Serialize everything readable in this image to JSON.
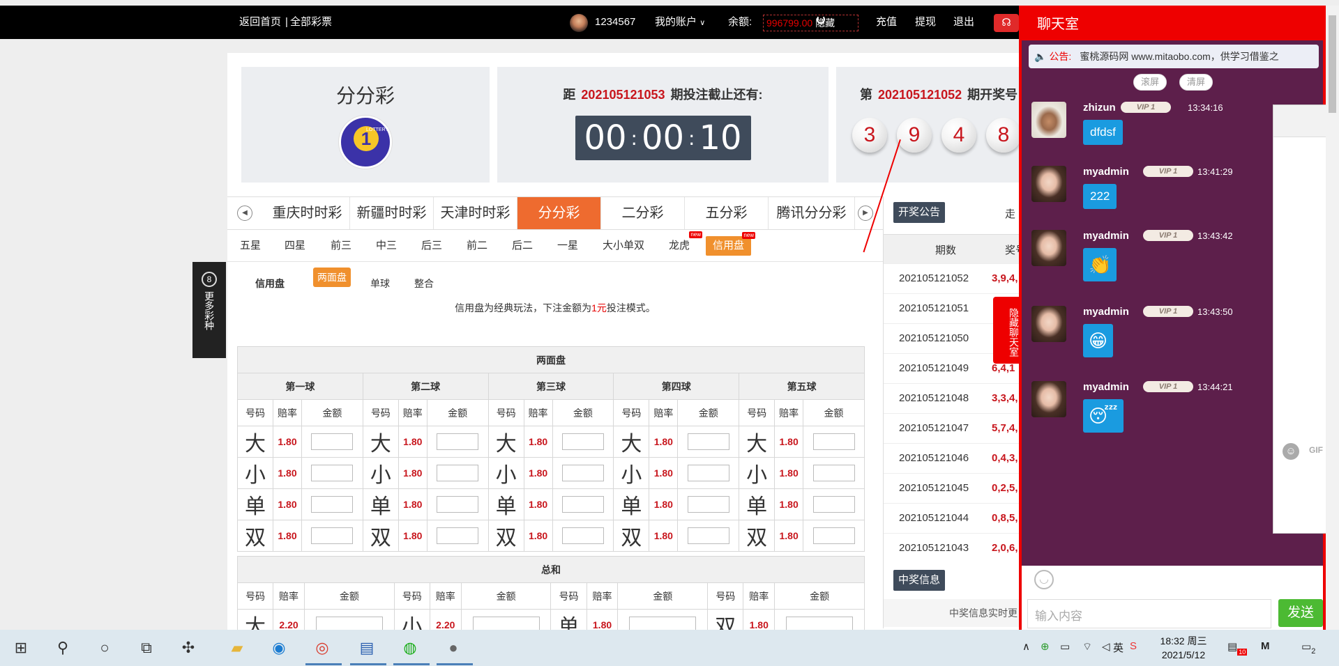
{
  "topbar": {
    "home_link": "返回首页",
    "separator": "|",
    "all_lottery_link": "全部彩票",
    "username": "1234567",
    "my_account": "我的账户",
    "balance_label": "余额:",
    "balance_value": "996799.00",
    "hide_label": "隐藏",
    "recharge": "充值",
    "withdraw": "提现",
    "logout": "退出"
  },
  "game_card": {
    "title": "分分彩",
    "logo_text": "1",
    "logo_sub": "LOTTERY"
  },
  "countdown": {
    "prefix": "距",
    "issue": "202105121053",
    "suffix": "期投注截止还有:",
    "hh": "00",
    "mm": "00",
    "ss": "10",
    "sep": ":"
  },
  "draw": {
    "prefix": "第",
    "issue": "202105121052",
    "suffix": "期开奖号",
    "balls": [
      "3",
      "9",
      "4",
      "8"
    ]
  },
  "tabs": [
    "重庆时时彩",
    "新疆时时彩",
    "天津时时彩",
    "分分彩",
    "二分彩",
    "五分彩",
    "腾讯分分彩"
  ],
  "active_tab_index": 3,
  "subtabs": [
    "五星",
    "四星",
    "前三",
    "中三",
    "后三",
    "前二",
    "后二",
    "一星",
    "大小单双",
    "龙虎",
    "信用盘"
  ],
  "new_badge": "new",
  "play_tabs": {
    "label": "信用盘",
    "items": [
      "两面盘",
      "单球",
      "整合"
    ],
    "active": "两面盘"
  },
  "description": {
    "before": "信用盘为经典玩法，下注金额为",
    "highlight": "1元",
    "after": "投注模式。"
  },
  "side_panel": {
    "number": "8",
    "text": "更多彩种"
  },
  "two_sided": {
    "title": "两面盘",
    "balls": [
      "第一球",
      "第二球",
      "第三球",
      "第四球",
      "第五球"
    ],
    "col_headers": [
      "号码",
      "赔率",
      "金额"
    ],
    "rows": [
      {
        "label": "大",
        "odds": "1.80"
      },
      {
        "label": "小",
        "odds": "1.80"
      },
      {
        "label": "单",
        "odds": "1.80"
      },
      {
        "label": "双",
        "odds": "1.80"
      }
    ]
  },
  "total_sum": {
    "title": "总和",
    "col_headers": [
      "号码",
      "赔率",
      "金额"
    ],
    "cells": [
      {
        "label": "大",
        "odds": "2.20"
      },
      {
        "label": "小",
        "odds": "2.20"
      },
      {
        "label": "单",
        "odds": "1.80"
      },
      {
        "label": "双",
        "odds": "1.80"
      }
    ]
  },
  "results": {
    "button": "开奖公告",
    "trend_label": "走",
    "col_issue": "期数",
    "col_number": "奖号",
    "rows": [
      {
        "issue": "202105121052",
        "nums": "3,9,4,"
      },
      {
        "issue": "202105121051",
        "nums": ""
      },
      {
        "issue": "202105121050",
        "nums": ""
      },
      {
        "issue": "202105121049",
        "nums": "6,4,1"
      },
      {
        "issue": "202105121048",
        "nums": "3,3,4,"
      },
      {
        "issue": "202105121047",
        "nums": "5,7,4,"
      },
      {
        "issue": "202105121046",
        "nums": "0,4,3,"
      },
      {
        "issue": "202105121045",
        "nums": "0,2,5,"
      },
      {
        "issue": "202105121044",
        "nums": "0,8,5,"
      },
      {
        "issue": "202105121043",
        "nums": "2,0,6,"
      }
    ],
    "winner_button": "中奖信息",
    "winner_text": "中奖信息实时更"
  },
  "hide_chat": "隐藏聊天室",
  "chat": {
    "title": "聊天室",
    "notice_label": "公告:",
    "notice_text": "蜜桃源码网 www.mitaobo.com，供学习借鉴之",
    "scroll_btn": "滚屏",
    "clear_btn": "清屏",
    "vip_label": "VIP 1",
    "messages": [
      {
        "user": "zhizun",
        "time": "13:34:16",
        "text": "dfdsf"
      },
      {
        "user": "myadmin",
        "time": "13:41:29",
        "text": "222"
      },
      {
        "user": "myadmin",
        "time": "13:43:42",
        "text": "👏"
      },
      {
        "user": "myadmin",
        "time": "13:43:50",
        "text": "😁"
      },
      {
        "user": "myadmin",
        "time": "13:44:21",
        "text": "😴"
      }
    ],
    "input_placeholder": "输入内容",
    "send": "发送",
    "gif": "GIF"
  },
  "taskbar": {
    "time": "18:32 周三",
    "date": "2021/5/12",
    "ime": "英",
    "badge": "10",
    "notif": "2"
  }
}
